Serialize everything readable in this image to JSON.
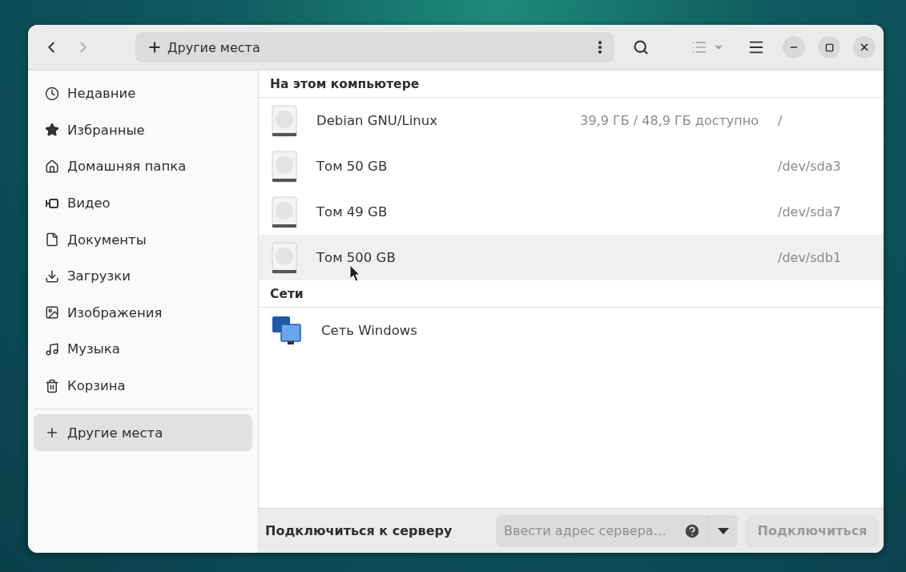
{
  "header": {
    "back": {
      "disabled": false
    },
    "forward": {
      "disabled": true
    },
    "location": {
      "label": "Другие места"
    },
    "view_toggle": {
      "disabled": true
    }
  },
  "sidebar": {
    "items": [
      {
        "kind": "recent",
        "label": "Недавние",
        "selected": false
      },
      {
        "kind": "starred",
        "label": "Избранные",
        "selected": false
      },
      {
        "kind": "home",
        "label": "Домашняя папка",
        "selected": false
      },
      {
        "kind": "video",
        "label": "Видео",
        "selected": false
      },
      {
        "kind": "documents",
        "label": "Документы",
        "selected": false
      },
      {
        "kind": "downloads",
        "label": "Загрузки",
        "selected": false
      },
      {
        "kind": "pictures",
        "label": "Изображения",
        "selected": false
      },
      {
        "kind": "music",
        "label": "Музыка",
        "selected": false
      },
      {
        "kind": "trash",
        "label": "Корзина",
        "selected": false
      }
    ],
    "other": {
      "kind": "other",
      "label": "Другие места",
      "selected": true
    }
  },
  "sections": [
    {
      "title": "На этом компьютере",
      "rows": [
        {
          "kind": "drive",
          "name": "Debian GNU/Linux",
          "usage": "39,9 ГБ / 48,9 ГБ доступно",
          "path": "/",
          "hovered": false
        },
        {
          "kind": "drive",
          "name": "Том 50 GB",
          "path": "/dev/sda3",
          "hovered": false
        },
        {
          "kind": "drive",
          "name": "Том 49 GB",
          "path": "/dev/sda7",
          "hovered": false
        },
        {
          "kind": "drive",
          "name": "Том 500 GB",
          "path": "/dev/sdb1",
          "hovered": true
        }
      ]
    },
    {
      "title": "Сети",
      "rows": [
        {
          "kind": "network",
          "name": "Сеть Windows",
          "hovered": false
        }
      ]
    }
  ],
  "connect_bar": {
    "label": "Подключиться к серверу",
    "placeholder": "Ввести адрес сервера…",
    "button": {
      "label": "Подключиться",
      "disabled": true
    }
  }
}
